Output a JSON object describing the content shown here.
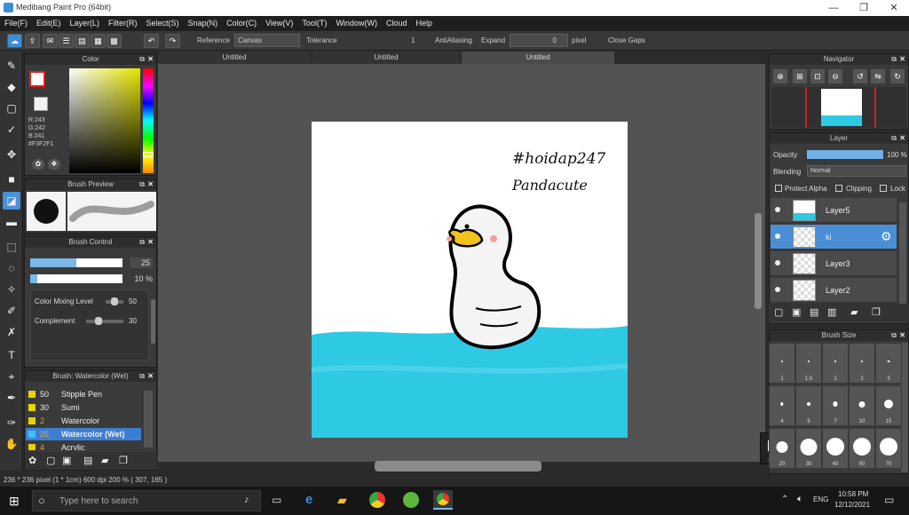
{
  "window": {
    "title": "Medibang Paint Pro (64bit)",
    "minimize": "—",
    "maximize": "❐",
    "close": "✕"
  },
  "menu": [
    "File(F)",
    "Edit(E)",
    "Layer(L)",
    "Filter(R)",
    "Select(S)",
    "Snap(N)",
    "Color(C)",
    "View(V)",
    "Tool(T)",
    "Window(W)",
    "Cloud",
    "Help"
  ],
  "toolbar": {
    "reference_label": "Reference",
    "reference_value": "Canvas",
    "tolerance_label": "Tolerance",
    "tolerance_value": "1",
    "antialiasing_label": "AntiAliasing",
    "expand_label": "Expand",
    "expand_value": "0",
    "pixel_label": "pixel",
    "close_gaps_label": "Close Gaps"
  },
  "tabs": [
    "Untitled",
    "Untitled",
    "Untitled"
  ],
  "color_panel": {
    "title": "Color",
    "r": "R:243",
    "g": "G:242",
    "b": "B:241",
    "hex": "#F3F2F1"
  },
  "brush_preview": {
    "title": "Brush Preview"
  },
  "brush_control": {
    "title": "Brush Control",
    "size_value": "25",
    "opacity_value": "10 %",
    "mixing_label": "Color Mixing Level",
    "mixing_value": "50",
    "complement_label": "Complement",
    "complement_value": "30"
  },
  "brush_list": {
    "title": "Brush: Watercolor (Wet)",
    "items": [
      {
        "num": "50",
        "name": "Stipple Pen",
        "color": "#e8d400"
      },
      {
        "num": "30",
        "name": "Sumi",
        "color": "#e8d400"
      },
      {
        "num": "2",
        "name": "Watercolor",
        "color": "#e8d400"
      },
      {
        "num": "25",
        "name": "Watercolor (Wet)",
        "color": "#40c0ff"
      },
      {
        "num": "4",
        "name": "Acrylic",
        "color": "#e8d400"
      }
    ]
  },
  "canvas": {
    "text1": "#hoidap247",
    "text2": "Pandacute"
  },
  "navigator": {
    "title": "Navigator"
  },
  "layer_panel": {
    "title": "Layer",
    "opacity_label": "Opacity",
    "opacity_value": "100 %",
    "blending_label": "Blending",
    "blending_value": "Normal",
    "protect_alpha": "Protect Alpha",
    "clipping": "Clipping",
    "lock": "Lock",
    "layers": [
      "Layer5",
      "ki",
      "Layer3",
      "Layer2"
    ]
  },
  "brush_size": {
    "title": "Brush Size",
    "labels": [
      "1",
      "1.5",
      "1",
      "2",
      "3",
      "4",
      "5",
      "7",
      "10",
      "15",
      "20",
      "30",
      "40",
      "50",
      "70"
    ]
  },
  "status": {
    "text": "236 * 236 pixel   (1 * 1cm)   600 dpi   200 %   ( 307, 165 )"
  },
  "taskbar": {
    "search_placeholder": "Type here to search",
    "time": "10:58 PM",
    "date": "12/12/2021",
    "lang": "ENG"
  },
  "colors": {
    "accent": "#4a90d9",
    "water": "#2ec9e3",
    "beak": "#f0c020"
  }
}
